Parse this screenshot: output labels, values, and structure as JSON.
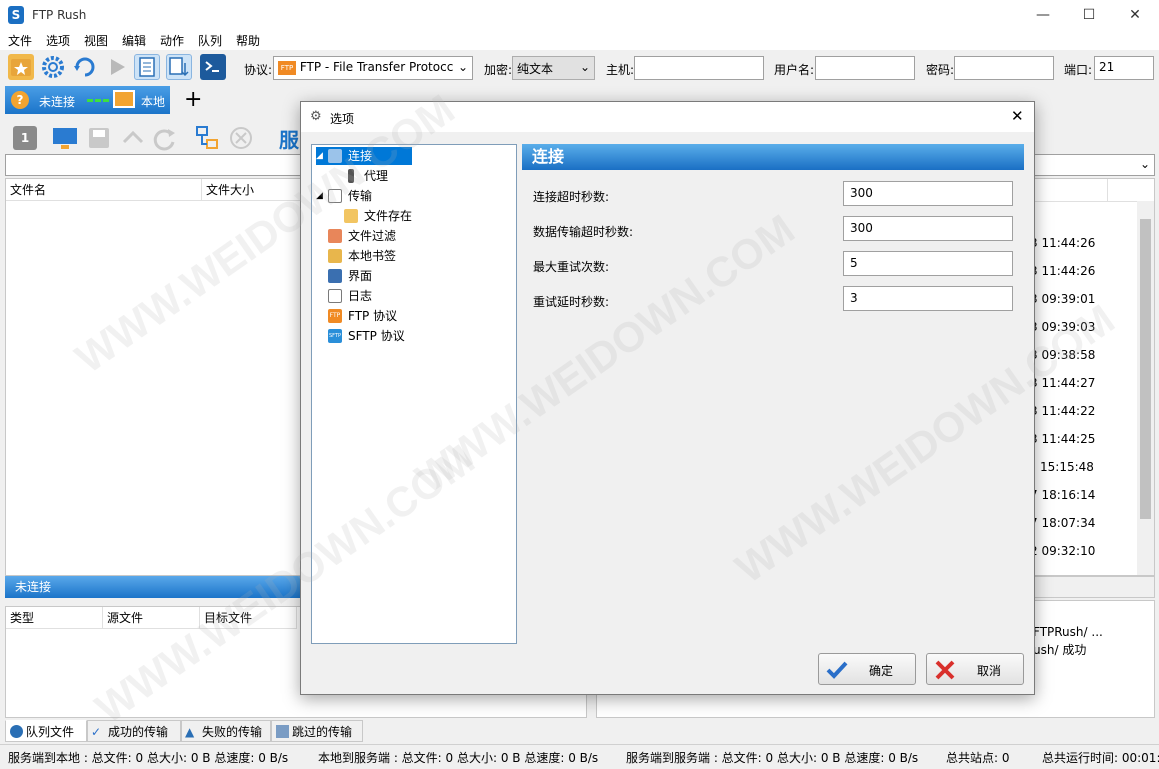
{
  "window": {
    "title": "FTP Rush"
  },
  "menu": [
    "文件",
    "选项",
    "视图",
    "编辑",
    "动作",
    "队列",
    "帮助"
  ],
  "toolbar": {
    "protocol_label": "协议:",
    "protocol_value": "FTP - File Transfer Protocc",
    "encrypt_label": "加密:",
    "encrypt_value": "纯文本",
    "host_label": "主机:",
    "host_value": "",
    "user_label": "用户名:",
    "user_value": "",
    "pass_label": "密码:",
    "pass_value": "",
    "port_label": "端口:",
    "port_value": "21"
  },
  "tabs": {
    "status": "未连接",
    "local": "本地",
    "add": "+"
  },
  "local_panel": {
    "page_badge": "1",
    "server_partial": "服"
  },
  "file_list": {
    "col_name": "文件名",
    "col_size": "文件大小"
  },
  "log_times": [
    "3 11:44:26",
    "3 11:44:26",
    "3 09:39:01",
    "3 09:39:03",
    "3 09:38:58",
    "3 11:44:27",
    "3 11:44:22",
    "3 11:44:25",
    "15:15:48",
    "7 18:16:14",
    "7 18:07:34",
    "2 09:32:10"
  ],
  "connection_strip": "未连接",
  "queue": {
    "col_type": "类型",
    "col_source": "源文件",
    "col_target": "目标文件"
  },
  "right_log": {
    "line1": "FTPRush/ ...",
    "line2": "ush/ 成功"
  },
  "bottom_tabs": [
    "队列文件",
    "成功的传输",
    "失败的传输",
    "跳过的传输"
  ],
  "statusbar": {
    "s1": "服务端到本地 : 总文件: 0  总大小: 0 B  总速度: 0 B/s",
    "s2": "本地到服务端 : 总文件: 0  总大小: 0 B  总速度: 0 B/s",
    "s3": "服务端到服务端 : 总文件: 0  总大小: 0 B  总速度: 0 B/s",
    "s4": "总共站点: 0",
    "s5": "总共运行时间: 00:01:"
  },
  "dialog": {
    "title": "选项",
    "tree": [
      {
        "label": "连接",
        "icon": "connection-icon",
        "selected": true
      },
      {
        "label": "代理",
        "icon": "proxy-icon"
      },
      {
        "label": "传输",
        "icon": "transfer-icon"
      },
      {
        "label": "文件存在",
        "icon": "file-exists-icon"
      },
      {
        "label": "文件过滤",
        "icon": "filter-icon"
      },
      {
        "label": "本地书签",
        "icon": "folder-icon"
      },
      {
        "label": "界面",
        "icon": "interface-icon"
      },
      {
        "label": "日志",
        "icon": "log-icon"
      },
      {
        "label": "FTP 协议",
        "icon": "ftp-icon"
      },
      {
        "label": "SFTP 协议",
        "icon": "sftp-icon"
      }
    ],
    "section_title": "连接",
    "fields": [
      {
        "label": "连接超时秒数:",
        "value": "300"
      },
      {
        "label": "数据传输超时秒数:",
        "value": "300"
      },
      {
        "label": "最大重试次数:",
        "value": "5"
      },
      {
        "label": "重试延时秒数:",
        "value": "3"
      }
    ],
    "ok_label": "确定",
    "cancel_label": "取消"
  },
  "watermark": "WWW.WEIDOWN.COM",
  "colors": {
    "accent": "#1b74c9",
    "ok_check": "#2a6fc9",
    "cancel_x": "#d9302c"
  }
}
